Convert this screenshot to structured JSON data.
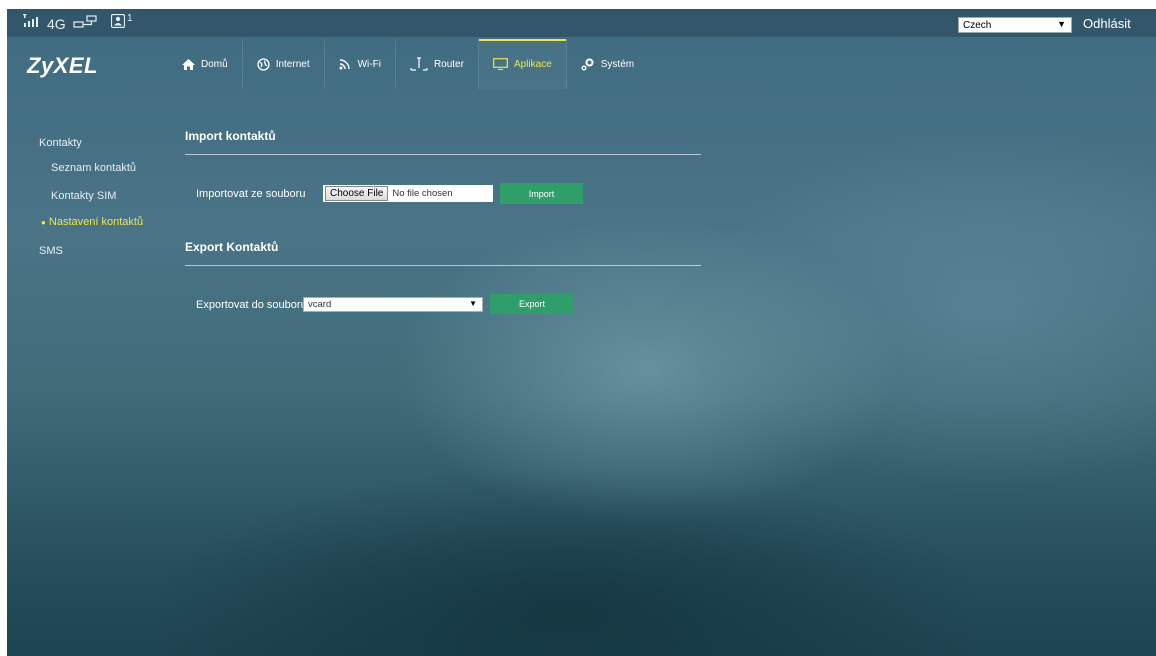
{
  "status": {
    "network_type": "4G",
    "user_count": "1",
    "icons": [
      "signal-icon",
      "lan-icon",
      "user-icon"
    ]
  },
  "header": {
    "logo": "ZyXEL",
    "language": "Czech",
    "logout": "Odhlásit",
    "nav": [
      {
        "label": "Domů",
        "icon": "home-icon"
      },
      {
        "label": "Internet",
        "icon": "globe-icon"
      },
      {
        "label": "Wi-Fi",
        "icon": "wifi-icon"
      },
      {
        "label": "Router",
        "icon": "router-icon"
      },
      {
        "label": "Aplikace",
        "icon": "monitor-icon",
        "active": true
      },
      {
        "label": "Systém",
        "icon": "gear-icon"
      }
    ]
  },
  "sidebar": {
    "items": [
      {
        "label": "Kontakty"
      },
      {
        "label": "Seznam kontaktů"
      },
      {
        "label": "Kontakty SIM"
      },
      {
        "label": "Nastavení kontaktů",
        "active": true
      },
      {
        "label": "SMS"
      }
    ]
  },
  "import": {
    "title": "Import kontaktů",
    "label": "Importovat ze souboru",
    "choose_file": "Choose File",
    "no_file": "No file chosen",
    "button": "Import"
  },
  "export": {
    "title": "Export Kontaktů",
    "label": "Exportovat do souboru",
    "format": "vcard",
    "button": "Export"
  },
  "colors": {
    "accent": "#e8e650",
    "button": "#2f9e6a"
  }
}
